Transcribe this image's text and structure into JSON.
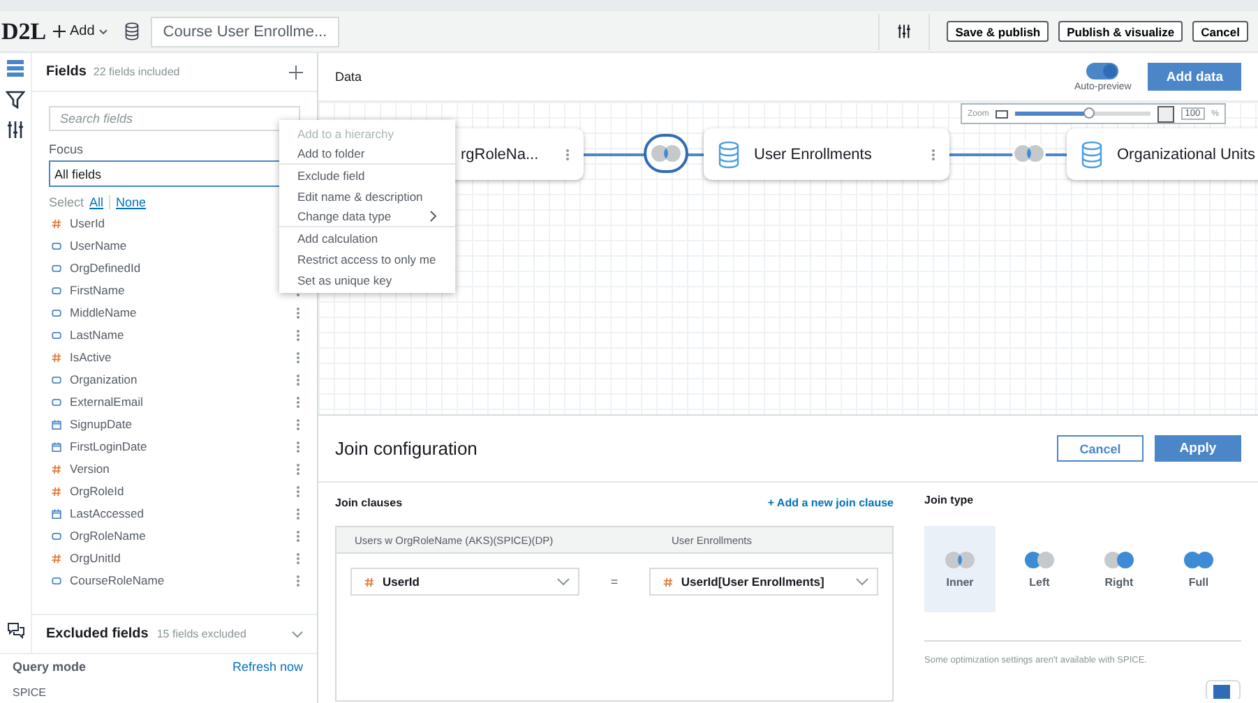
{
  "toolbar": {
    "logo": "D2L",
    "add_button": "Add",
    "dataset_name": "Course User Enrollme...",
    "buttons": [
      "Save & publish",
      "Publish & visualize",
      "Cancel"
    ]
  },
  "rail": [
    {
      "kind": "fields",
      "selected": true
    },
    {
      "kind": "filter",
      "selected": false
    },
    {
      "kind": "settings",
      "selected": false
    }
  ],
  "fields_panel": {
    "title": "Fields",
    "count": "22 fields included",
    "search": {
      "placeholder": "Search fields"
    },
    "focus_label": "Focus",
    "focus_value": "All fields",
    "select_label": "Select",
    "select_all": "All",
    "select_none": "None",
    "fields": [
      {
        "name": "UserId",
        "kind": "number"
      },
      {
        "name": "UserName",
        "kind": "text"
      },
      {
        "name": "OrgDefinedId",
        "kind": "text"
      },
      {
        "name": "FirstName",
        "kind": "text"
      },
      {
        "name": "MiddleName",
        "kind": "text"
      },
      {
        "name": "LastName",
        "kind": "text"
      },
      {
        "name": "IsActive",
        "kind": "number"
      },
      {
        "name": "Organization",
        "kind": "text"
      },
      {
        "name": "ExternalEmail",
        "kind": "text"
      },
      {
        "name": "SignupDate",
        "kind": "date"
      },
      {
        "name": "FirstLoginDate",
        "kind": "date"
      },
      {
        "name": "Version",
        "kind": "number"
      },
      {
        "name": "OrgRoleId",
        "kind": "number"
      },
      {
        "name": "LastAccessed",
        "kind": "date"
      },
      {
        "name": "OrgRoleName",
        "kind": "text"
      },
      {
        "name": "OrgUnitId",
        "kind": "number"
      },
      {
        "name": "CourseRoleName",
        "kind": "text"
      }
    ],
    "excluded_title": "Excluded fields",
    "excluded_count": "15 fields excluded"
  },
  "query_mode": {
    "label": "Query mode",
    "action": "Refresh now",
    "value": "SPICE"
  },
  "context_menu": [
    {
      "label": "Add to a hierarchy",
      "disabled": true,
      "divider_after": false,
      "submenu": false
    },
    {
      "label": "Add to folder",
      "disabled": false,
      "divider_after": true,
      "submenu": false
    },
    {
      "label": "Exclude field",
      "disabled": false,
      "divider_after": false,
      "submenu": false
    },
    {
      "label": "Edit name & description",
      "disabled": false,
      "divider_after": false,
      "submenu": false
    },
    {
      "label": "Change data type",
      "disabled": false,
      "divider_after": true,
      "submenu": true
    },
    {
      "label": "Add calculation",
      "disabled": false,
      "divider_after": false,
      "submenu": false
    },
    {
      "label": "Restrict access to only me",
      "disabled": false,
      "divider_after": false,
      "submenu": false
    },
    {
      "label": "Set as unique key",
      "disabled": false,
      "divider_after": false,
      "submenu": false
    }
  ],
  "data_header": {
    "title": "Data",
    "auto_preview": {
      "label": "Auto-preview",
      "on": true
    },
    "add_data": "Add data"
  },
  "zoom": {
    "label": "Zoom",
    "level": 0.55,
    "value": "100",
    "unit": "%"
  },
  "nodes": [
    {
      "name": "rgRoleNa..."
    },
    {
      "name": "User Enrollments"
    },
    {
      "name": "Organizational Units"
    }
  ],
  "joins": [
    {
      "selected": true
    },
    {
      "selected": false
    }
  ],
  "join_config": {
    "title": "Join configuration",
    "cancel": "Cancel",
    "apply": "Apply",
    "clauses_title": "Join clauses",
    "add_clause": "+ Add a new join clause",
    "left_header": "Users w OrgRoleName (AKS)(SPICE)(DP)",
    "right_header": "User Enrollments",
    "left_field": "UserId",
    "equals": "=",
    "right_field": "UserId[User Enrollments]",
    "join_type_title": "Join type",
    "join_types": [
      {
        "label": "Inner",
        "kind": "inner",
        "selected": true
      },
      {
        "label": "Left",
        "kind": "left",
        "selected": false
      },
      {
        "label": "Right",
        "kind": "right",
        "selected": false
      },
      {
        "label": "Full",
        "kind": "full",
        "selected": false
      }
    ],
    "note": "Some optimization settings aren't available with SPICE."
  }
}
